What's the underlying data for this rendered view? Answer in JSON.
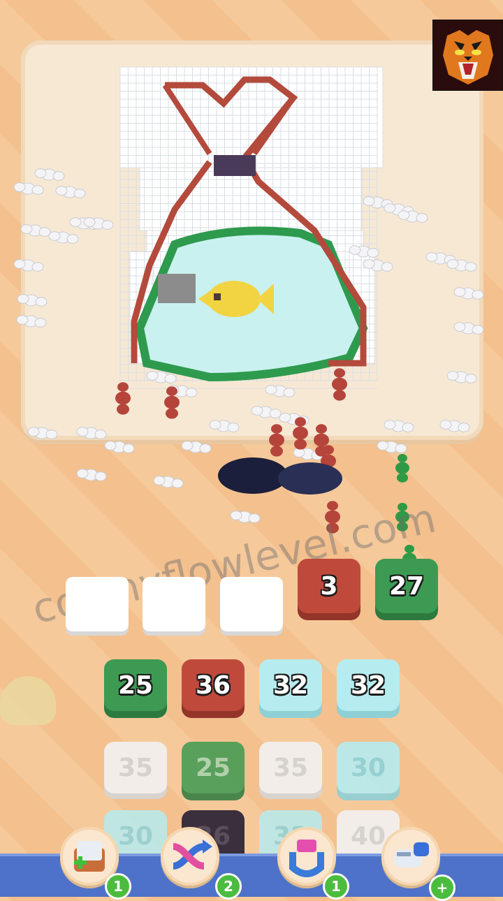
{
  "watermark": "colonyflowlevel.com",
  "logo": {
    "icon": "tiger-face-icon"
  },
  "puzzle": {
    "image": "goldfish-in-bag-pixel-art",
    "colors": {
      "grid": "#ffffff",
      "bag_outline": "#b34a3c",
      "knot": "#4a3a5a",
      "water": "#c9f1f0",
      "water_outline": "#2e9a4e",
      "fish": "#f2d443",
      "locked": "#8c8c8c"
    }
  },
  "collection_slots": {
    "empty_count": 3,
    "filled": [
      {
        "value": "3",
        "color": "red"
      },
      {
        "value": "27",
        "color": "green"
      }
    ]
  },
  "queue": {
    "row1": [
      {
        "value": "25",
        "color": "green"
      },
      {
        "value": "36",
        "color": "red"
      },
      {
        "value": "32",
        "color": "aqua"
      },
      {
        "value": "32",
        "color": "aqua"
      }
    ],
    "row2": [
      {
        "value": "35",
        "color": "white"
      },
      {
        "value": "25",
        "color": "green"
      },
      {
        "value": "35",
        "color": "white"
      },
      {
        "value": "30",
        "color": "aqua"
      }
    ],
    "row3": [
      {
        "value": "30",
        "color": "aqua"
      },
      {
        "value": "36",
        "color": "dark"
      },
      {
        "value": "32",
        "color": "aqua"
      },
      {
        "value": "40",
        "color": "white"
      }
    ]
  },
  "boosters": [
    {
      "name": "add-slot-icon",
      "count": "1"
    },
    {
      "name": "shuffle-icon",
      "count": "2"
    },
    {
      "name": "magnet-icon",
      "count": "1"
    },
    {
      "name": "vacuum-icon",
      "count": "+"
    }
  ]
}
